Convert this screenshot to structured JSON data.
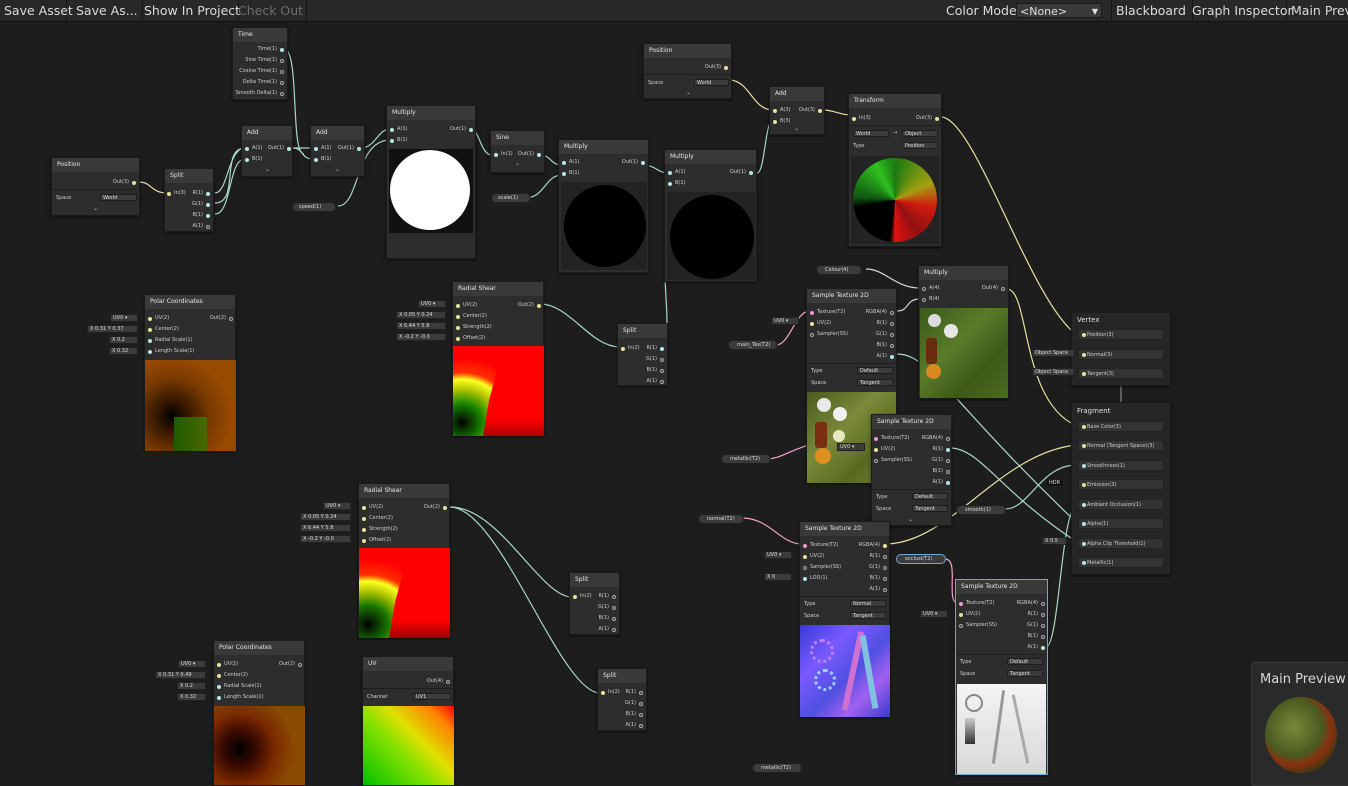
{
  "toolbar": {
    "save_asset": "Save Asset",
    "save_as": "Save As...",
    "show_in_project": "Show In Project",
    "check_out": "Check Out",
    "color_mode_label": "Color Mode",
    "color_mode_value": "<None>",
    "blackboard": "Blackboard",
    "graph_inspector": "Graph Inspector",
    "main_preview": "Main Preview"
  },
  "nodes": {
    "time": {
      "title": "Time",
      "outs": [
        "Time(1)",
        "Sine Time(1)",
        "Cosine Time(1)",
        "Delta Time(1)",
        "Smooth Delta(1)"
      ]
    },
    "position1": {
      "title": "Position",
      "out": "Out(3)",
      "space_label": "Space",
      "space_value": "World"
    },
    "split1": {
      "title": "Split",
      "in": "In(3)",
      "outs": [
        "R(1)",
        "G(1)",
        "B(1)",
        "A(1)"
      ]
    },
    "add1": {
      "title": "Add",
      "ins": [
        "A(1)",
        "B(1)"
      ],
      "out": "Out(1)"
    },
    "add2": {
      "title": "Add",
      "ins": [
        "A(1)",
        "B(1)"
      ],
      "out": "Out(1)"
    },
    "speed": {
      "label": "speed(1)"
    },
    "multiply1": {
      "title": "Multiply",
      "ins": [
        "A(1)",
        "B(1)"
      ],
      "out": "Out(1)"
    },
    "sine": {
      "title": "Sine",
      "in": "In(1)",
      "out": "Out(1)"
    },
    "scale": {
      "label": "scale(1)"
    },
    "multiply2": {
      "title": "Multiply",
      "ins": [
        "A(1)",
        "B(1)"
      ],
      "out": "Out(1)"
    },
    "multiply3": {
      "title": "Multiply",
      "ins": [
        "A(1)",
        "B(1)"
      ],
      "out": "Out(1)"
    },
    "position2": {
      "title": "Position",
      "out": "Out(3)",
      "space_label": "Space",
      "space_value": "World"
    },
    "add3": {
      "title": "Add",
      "ins": [
        "A(3)",
        "B(3)"
      ],
      "out": "Out(3)"
    },
    "transform": {
      "title": "Transform",
      "in": "In(3)",
      "out": "Out(3)",
      "from": "World",
      "to": "Object",
      "type_label": "Type",
      "type_value": "Position"
    },
    "polar1": {
      "title": "Polar Coordinates",
      "ins": [
        "UV(2)",
        "Center(2)",
        "Radial Scale(1)",
        "Length Scale(1)"
      ],
      "out": "Out(2)",
      "uv": "UV0",
      "cx": "0.31",
      "cy": "0.37",
      "radial": "0.2",
      "length": "0.32"
    },
    "radial1": {
      "title": "Radial Shear",
      "ins": [
        "UV(2)",
        "Center(2)",
        "Strength(2)",
        "Offset(2)"
      ],
      "out": "Out(2)",
      "uv": "UV0",
      "c": [
        "0.05",
        "0.24"
      ],
      "s": [
        "6.44",
        "5.8"
      ],
      "o": [
        "-0.2",
        "-0.0"
      ]
    },
    "split2": {
      "title": "Split",
      "in": "In(2)",
      "outs": [
        "R(1)",
        "G(1)",
        "B(1)",
        "A(1)"
      ]
    },
    "colour": {
      "label": "Colour(4)"
    },
    "maintex": {
      "label": "main_Tex(T2)"
    },
    "sample1": {
      "title": "Sample Texture 2D",
      "ins": [
        "Texture(T2)",
        "UV(2)",
        "Sampler(SS)"
      ],
      "outs": [
        "RGBA(4)",
        "R(1)",
        "G(1)",
        "B(1)",
        "A(1)"
      ],
      "uv": "UV0",
      "type_label": "Type",
      "type_value": "Default",
      "space_label": "Space",
      "space_value": "Tangent"
    },
    "multiply4": {
      "title": "Multiply",
      "ins": [
        "A(4)",
        "B(4)"
      ],
      "out": "Out(4)"
    },
    "vertex": {
      "title": "Vertex",
      "rows": [
        "Position(3)",
        "Normal(3)",
        "Tangent(3)"
      ],
      "normal_space": "Object Space",
      "tangent_space": "Object Space"
    },
    "fragment": {
      "title": "Fragment",
      "rows": [
        "Base Color(3)",
        "Normal (Tangent Space)(3)",
        "Smoothness(1)",
        "Emission(3)",
        "Ambient Occlusion(1)",
        "Alpha(1)",
        "Alpha Clip Threshold(1)",
        "Metallic(1)"
      ],
      "hdr": "HDR",
      "alpha_clip_x": "X",
      "alpha_clip_value": "0.5"
    },
    "metallic1": {
      "label": "metallic(T2)"
    },
    "sample2": {
      "title": "Sample Texture 2D",
      "ins": [
        "Texture(T2)",
        "UV(2)",
        "Sampler(SS)"
      ],
      "outs": [
        "RGBA(4)",
        "R(1)",
        "G(1)",
        "B(1)",
        "A(1)"
      ],
      "uv": "UV0",
      "type_label": "Type",
      "type_value": "Default",
      "space_label": "Space",
      "space_value": "Tangent"
    },
    "smooth": {
      "label": "smooth(1)"
    },
    "radial2": {
      "title": "Radial Shear",
      "ins": [
        "UV(2)",
        "Center(2)",
        "Strength(2)",
        "Offset(2)"
      ],
      "out": "Out(2)",
      "uv": "UV0",
      "c": [
        "0.05",
        "0.24"
      ],
      "s": [
        "6.44",
        "5.8"
      ],
      "o": [
        "-0.2",
        "-0.0"
      ]
    },
    "normal": {
      "label": "normal(T2)"
    },
    "sample3": {
      "title": "Sample Texture 2D",
      "ins": [
        "Texture(T2)",
        "UV(2)",
        "Sampler(SS)",
        "LOD(1)"
      ],
      "outs": [
        "RGBA(4)",
        "R(1)",
        "G(1)",
        "B(1)",
        "A(1)"
      ],
      "uv": "UV0",
      "lod_x": "X",
      "lod": "0",
      "type_label": "Type",
      "type_value": "Normal",
      "space_label": "Space",
      "space_value": "Tangent"
    },
    "occlusi": {
      "label": "occlusi(T2)"
    },
    "sample4": {
      "title": "Sample Texture 2D",
      "ins": [
        "Texture(T2)",
        "UV(2)",
        "Sampler(SS)"
      ],
      "outs": [
        "RGBA(4)",
        "R(1)",
        "G(1)",
        "B(1)",
        "A(1)"
      ],
      "uv": "UV0",
      "type_label": "Type",
      "type_value": "Default",
      "space_label": "Space",
      "space_value": "Tangent"
    },
    "split3": {
      "title": "Split",
      "in": "In(2)",
      "outs": [
        "R(1)",
        "G(1)",
        "B(1)",
        "A(1)"
      ]
    },
    "split4": {
      "title": "Split",
      "in": "In(2)",
      "outs": [
        "R(1)",
        "G(1)",
        "B(1)",
        "A(1)"
      ]
    },
    "polar2": {
      "title": "Polar Coordinates",
      "ins": [
        "UV(2)",
        "Center(2)",
        "Radial Scale(1)",
        "Length Scale(1)"
      ],
      "out": "Out(2)",
      "uv": "UV0",
      "cx": "0.31",
      "cy": "0.49",
      "radial": "0.2",
      "length": "0.32"
    },
    "uvnode": {
      "title": "UV",
      "out": "Out(4)",
      "channel_label": "Channel",
      "channel_value": "UV1"
    },
    "metallic2": {
      "label": "metallic(T2)"
    }
  },
  "axis_letters": {
    "x": "X",
    "y": "Y"
  },
  "main_preview_panel": {
    "title": "Main Preview"
  },
  "colors": {
    "background": "#1d1d1d",
    "node": "#2d2d2d",
    "node_header": "#393939",
    "float_wire": "#a8d8c8",
    "vector_wire": "#e2e2a0",
    "texture_wire": "#f4a6c8",
    "selection": "#6fa9cf"
  }
}
